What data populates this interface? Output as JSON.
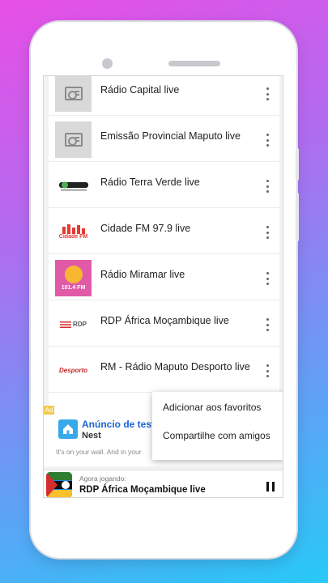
{
  "stations": [
    {
      "title": "Rádio Capital live",
      "logo": "radio-placeholder-icon"
    },
    {
      "title": "Emissão Provincial Maputo live",
      "logo": "radio-placeholder-icon"
    },
    {
      "title": "Rádio Terra Verde live",
      "logo": "terra-verde-logo"
    },
    {
      "title": "Cidade FM 97.9 live",
      "logo": "cidade-fm-logo",
      "logo_text": "Cidade FM"
    },
    {
      "title": "Rádio Miramar live",
      "logo": "miramar-logo",
      "logo_text": "101.4 FM"
    },
    {
      "title": "RDP África Moçambique live",
      "logo": "rdp-logo",
      "logo_text": "RDP"
    },
    {
      "title": "RM - Rádio Maputo Desporto live",
      "logo": "desporto-logo",
      "logo_text": "Desporto"
    }
  ],
  "ad": {
    "badge": "Ad",
    "title": "Anúncio de teste",
    "advertiser": "Nest",
    "description": "It's on your wall. And in your"
  },
  "context_menu": {
    "items": [
      "Adicionar aos favoritos",
      "Compartilhe com amigos"
    ]
  },
  "player": {
    "caption": "Agora jogando:",
    "title": "RDP África Moçambique live"
  },
  "colors": {
    "ad_title": "#1a63d6",
    "ad_badge": "#f3c94d",
    "miramar": "#e05aa8"
  }
}
